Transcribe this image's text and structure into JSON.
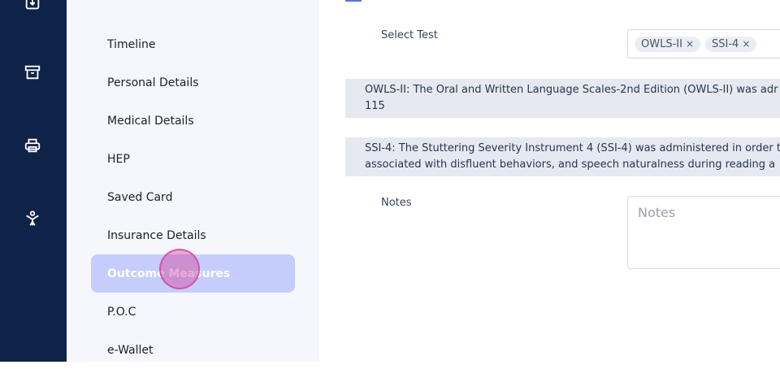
{
  "sidebar": {
    "items": [
      {
        "label": "Timeline"
      },
      {
        "label": "Personal Details"
      },
      {
        "label": "Medical Details"
      },
      {
        "label": "HEP"
      },
      {
        "label": "Saved Card"
      },
      {
        "label": "Insurance Details"
      },
      {
        "label": "Outcome Measures"
      },
      {
        "label": "P.O.C"
      },
      {
        "label": "e-Wallet"
      }
    ],
    "active_index": 6
  },
  "rail": {
    "icons": [
      "download-box-icon",
      "archive-icon",
      "printer-icon",
      "person-icon"
    ]
  },
  "form": {
    "select_test_label": "Select Test",
    "selected_tests": [
      "OWLS-II",
      "SSI-4"
    ],
    "chip_remove_glyph": "×",
    "descriptions": [
      {
        "line1": "OWLS-II: The Oral and Written Language Scales-2nd Edition (OWLS-II) was adr",
        "line2": "115"
      },
      {
        "line1": "SSI-4: The Stuttering Severity Instrument 4 (SSI-4) was administered in order t",
        "line2": "associated with disfluent behaviors, and speech naturalness during reading a"
      }
    ],
    "notes_label": "Notes",
    "notes_placeholder": "Notes"
  },
  "colors": {
    "rail_bg": "#0f2247",
    "sidebar_bg": "#f5f7fc",
    "active_item_bg": "#c4cdfb",
    "info_bg": "#e6e9f0"
  }
}
